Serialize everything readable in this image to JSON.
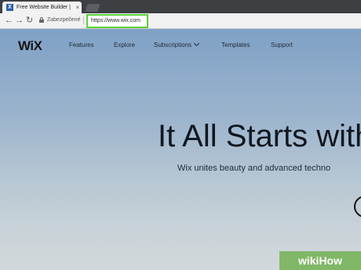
{
  "browser": {
    "tab_title": "Free Website Builder | C",
    "tab_close": "×",
    "back_icon": "←",
    "forward_icon": "→",
    "reload_icon": "↻",
    "secure_label": "Zabezpečené",
    "url": "https://www.wix.com",
    "favicon_text": "X"
  },
  "site": {
    "logo": "WiX",
    "nav": [
      "Features",
      "Explore",
      "Subscriptions",
      "Templates",
      "Support"
    ],
    "headline": "It All Starts with Y",
    "subline": "Wix unites beauty and advanced techno"
  },
  "watermark": "wikiHow",
  "colors": {
    "highlight": "#5bd13a",
    "watermark": "#78b45a"
  }
}
